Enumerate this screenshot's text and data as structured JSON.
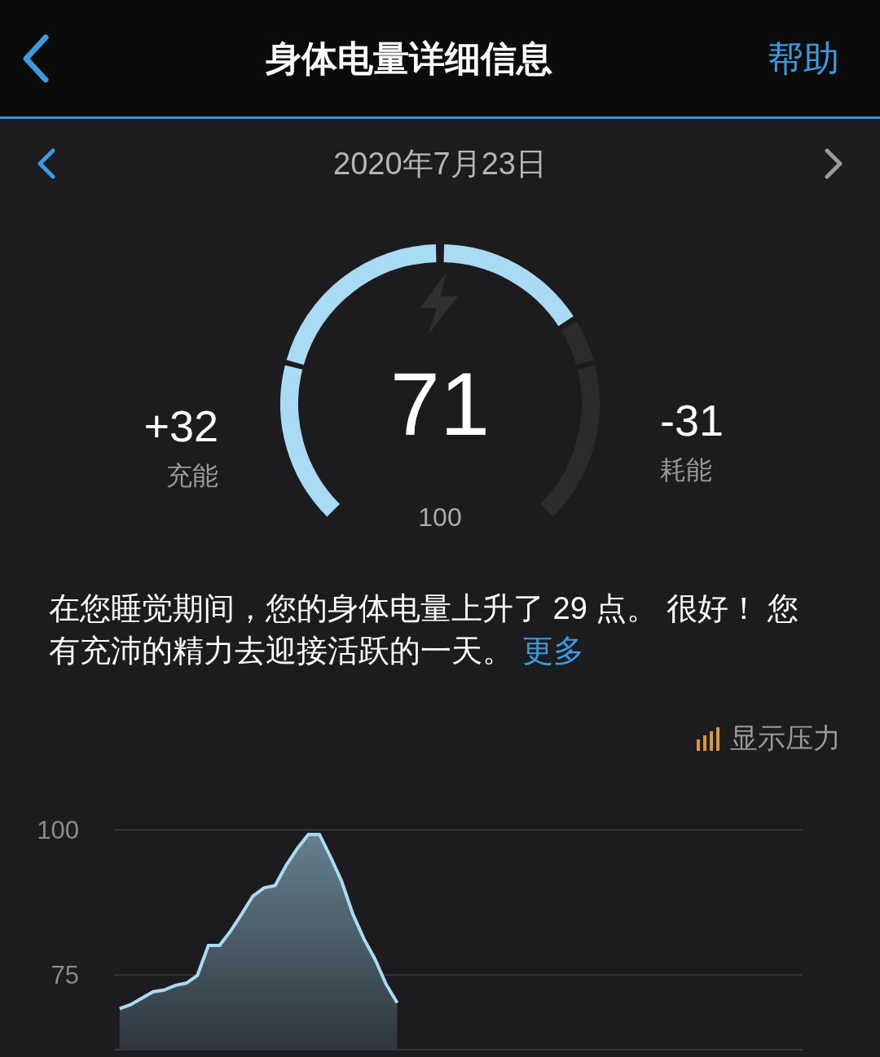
{
  "header": {
    "title": "身体电量详细信息",
    "help": "帮助"
  },
  "date_nav": {
    "date": "2020年7月23日"
  },
  "gauge": {
    "value": "71",
    "max": "100"
  },
  "charged": {
    "value": "+32",
    "label": "充能"
  },
  "drained": {
    "value": "-31",
    "label": "耗能"
  },
  "summary": {
    "text": "在您睡觉期间，您的身体电量上升了 29 点。 很好！ 您有充沛的精力去迎接活跃的一天。",
    "more": "更多"
  },
  "stress_toggle": {
    "label": "显示压力"
  },
  "chart": {
    "chart_data": {
      "type": "area",
      "ylim": [
        62,
        100
      ],
      "yticks": [
        {
          "value": 100,
          "label": "100"
        },
        {
          "value": 75,
          "label": "75"
        }
      ],
      "categories": [
        null,
        null,
        null,
        null,
        null,
        null,
        null,
        null,
        null,
        null,
        null,
        null,
        null,
        null,
        null,
        null,
        null,
        null,
        null,
        null,
        null,
        null,
        null,
        null,
        null,
        null,
        null,
        null,
        null,
        null,
        null,
        null,
        null,
        null,
        null,
        null,
        null,
        null,
        null,
        null,
        null,
        null,
        null,
        null,
        null,
        null,
        null,
        null,
        null,
        null,
        null,
        null,
        null,
        null,
        null,
        null,
        null,
        null,
        null,
        null,
        null,
        null
      ],
      "series": [
        {
          "color": "#a9dbf5",
          "values": [
            69.2,
            69.9,
            71,
            72.1,
            72.4,
            73.2,
            73.6,
            74.9,
            80.1,
            80.1,
            82.6,
            85.5,
            88.6,
            90,
            90.4,
            93.9,
            96.8,
            99.2,
            99.2,
            95.3,
            91.1,
            85.5,
            81.2,
            77.7,
            73.4,
            70.2,
            null,
            null,
            null,
            null,
            null,
            null,
            null,
            null,
            null,
            null,
            null,
            null,
            null,
            null,
            null,
            null,
            null,
            null,
            null,
            null,
            null,
            null,
            null,
            null,
            null,
            null,
            null,
            null,
            null,
            null,
            null,
            null,
            null,
            null,
            null,
            null
          ]
        }
      ]
    }
  }
}
